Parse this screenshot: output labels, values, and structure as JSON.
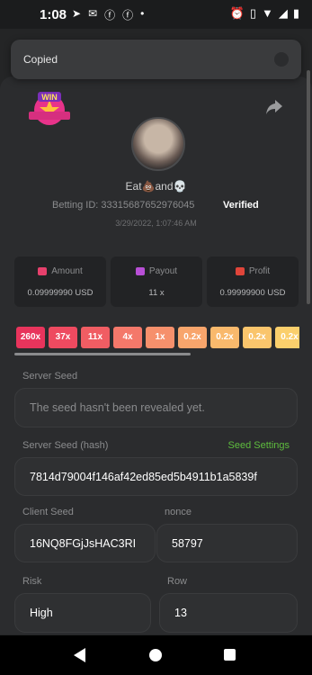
{
  "status_bar": {
    "time": "1:08",
    "left_icons": [
      "telegram-icon",
      "mail-icon",
      "facebook-icon",
      "facebook-icon",
      "dot-icon"
    ],
    "right_icons": [
      "alarm-icon",
      "vibrate-icon",
      "wifi-icon",
      "signal-icon",
      "battery-icon"
    ]
  },
  "toast": {
    "text": "Copied"
  },
  "profile": {
    "username": "Eat💩and💀",
    "betting_id": "Betting ID: 333156876529760​45",
    "verified": "Verified",
    "date": "3/29/2022, 1:07:46 AM"
  },
  "stats": [
    {
      "label": "Amount",
      "value": "0.09999990 USD",
      "color": "#e6406c",
      "icon": "coins-icon"
    },
    {
      "label": "Payout",
      "value": "11 x",
      "color": "#b84fd6",
      "icon": "wallet-icon"
    },
    {
      "label": "Profit",
      "value": "0.99999900 USD",
      "color": "#e0453a",
      "icon": "money-hand-icon"
    }
  ],
  "multipliers": [
    {
      "label": "260x",
      "color": "#e8345c"
    },
    {
      "label": "37x",
      "color": "#ee4a60"
    },
    {
      "label": "11x",
      "color": "#f05d63"
    },
    {
      "label": "4x",
      "color": "#f4786a"
    },
    {
      "label": "1x",
      "color": "#f6906c"
    },
    {
      "label": "0.2x",
      "color": "#f8a56c"
    },
    {
      "label": "0.2x",
      "color": "#f9b96c"
    },
    {
      "label": "0.2x",
      "color": "#fac56c"
    },
    {
      "label": "0.2x",
      "color": "#fbcf6c"
    }
  ],
  "fields": {
    "server_seed_label": "Server Seed",
    "server_seed_value": "The seed hasn't been revealed yet.",
    "server_hash_label": "Server Seed (hash)",
    "seed_settings": "Seed Settings",
    "server_hash_value": "7814d79004f146af42ed85ed5b4911b1a5839f",
    "client_seed_label": "Client Seed",
    "client_seed_value": "16NQ8FGjJsHAC3RI",
    "nonce_label": "nonce",
    "nonce_value": "58797",
    "risk_label": "Risk",
    "risk_value": "High",
    "row_label": "Row",
    "row_value": "13"
  }
}
